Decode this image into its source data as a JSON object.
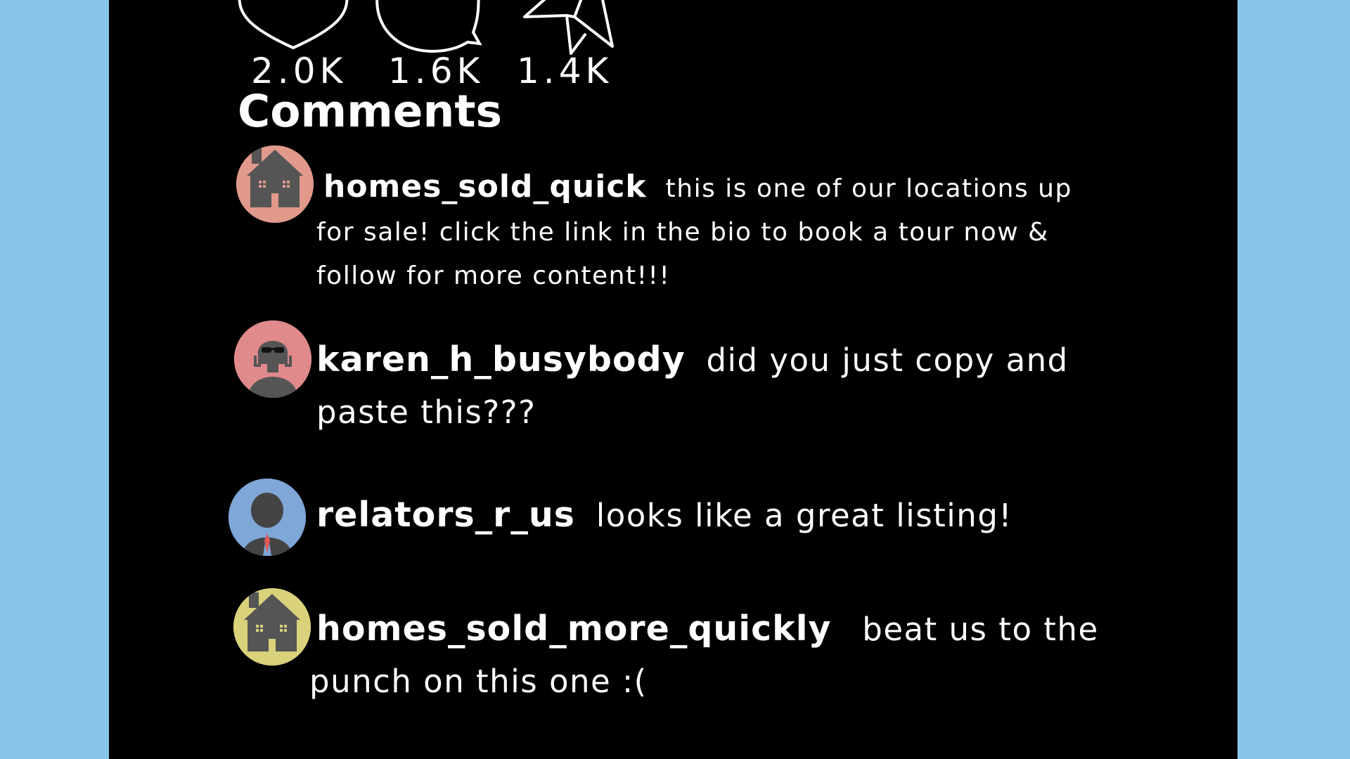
{
  "actions": [
    {
      "icon": "heart-icon",
      "count": "2.0K"
    },
    {
      "icon": "comment-bubble-icon",
      "count": "1.6K"
    },
    {
      "icon": "share-arrow-icon",
      "count": "1.4K"
    }
  ],
  "comments_heading": "Comments",
  "comments": [
    {
      "username": "homes_sold_quick",
      "text": "this is one of our locations up for sale! click the link in the bio to book a tour now & follow for more content!!!",
      "avatar": "house-icon",
      "avatar_color": "#e0998a"
    },
    {
      "username": "karen_h_busybody",
      "text": "did you just copy and paste this???",
      "avatar": "woman-sunglasses-icon",
      "avatar_color": "#e08a8c"
    },
    {
      "username": "relators_r_us",
      "text": "looks like a great listing!",
      "avatar": "businessman-icon",
      "avatar_color": "#7fa7d8"
    },
    {
      "username": "homes_sold_more_quickly",
      "text": "beat us to the punch on this one :(",
      "avatar": "house-icon",
      "avatar_color": "#d9d27a"
    }
  ],
  "colors": {
    "page_background": "#87c4e8",
    "panel_background": "#000000",
    "text": "#ffffff",
    "avatar_figure": "#555555"
  }
}
